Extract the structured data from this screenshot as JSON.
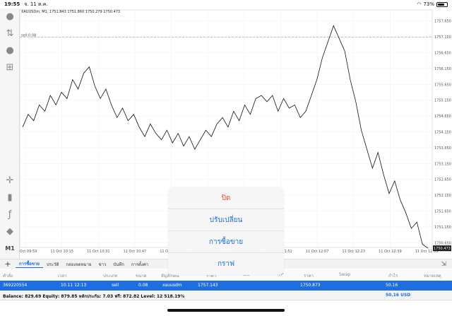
{
  "status_bar": {
    "time": "19:55",
    "date": "จ. 11 ต.ค.",
    "battery": "73%",
    "battery_level": 0.73
  },
  "chart": {
    "symbol_info": "XAUUSDm, M1, 1751.843 1751.860 1750.279 1750.473",
    "sell_label": "sell 0.08",
    "current_price_label": "1750.473",
    "timeframe": "M1"
  },
  "tabs": [
    "การซื้อขาย",
    "ประวัติ",
    "กล่องจดหมาย",
    "ข่าว",
    "บันทึก",
    "การตั้งค่า"
  ],
  "table": {
    "headers": [
      "คำสั่ง",
      "เวลา",
      "ประเภท",
      "ขนาด",
      "สัญลักษณ์",
      "ราคา",
      "S/L",
      "T/P",
      "ราคา",
      "Swap",
      "กำไร",
      "หมายเหตุ"
    ],
    "row": [
      "369220554",
      "10.11 12:13",
      "sell",
      "0.08",
      "xauusdm",
      "1757.143",
      "",
      "",
      "1750.873",
      "",
      "50.16",
      ""
    ]
  },
  "balance": {
    "text": "Balance: 829.69 Equity: 879.85 หลักประกัน: 7.03 ฟรี: 872.82 Level: 12 518.19%",
    "profit": "50.16  USD"
  },
  "sheet": {
    "options": [
      "ปิด",
      "ปรับเปลี่ยน",
      "การซื้อขาย",
      "กราฟ"
    ]
  },
  "chart_data": {
    "type": "line",
    "title": "XAUUSDm, M1, 1751.843 1751.860 1750.279 1750.473",
    "x_ticks": [
      "11 Oct 09:59",
      "11 Oct 10:15",
      "11 Oct 10:31",
      "11 Oct 10:47",
      "11 Oct 11:03",
      "11 Oct 11:19",
      "11 Oct 11:35",
      "11 Oct 11:51",
      "11 Oct 12:07",
      "11 Oct 12:23",
      "11 Oct 12:39",
      "11 Oct 12:55"
    ],
    "y_ticks": [
      1757.65,
      1757.15,
      1756.65,
      1756.15,
      1755.65,
      1755.15,
      1754.65,
      1754.15,
      1753.65,
      1753.15,
      1752.65,
      1752.15,
      1751.65,
      1751.15,
      1750.65
    ],
    "ylim": [
      1750.5,
      1758.0
    ],
    "sell_level": 1757.143,
    "last_price": 1750.473,
    "series": [
      {
        "values": [
          1754.3,
          1754.7,
          1754.5,
          1755.0,
          1754.8,
          1755.3,
          1755.0,
          1755.4,
          1755.2,
          1755.8,
          1755.5,
          1756.0,
          1756.2,
          1755.6,
          1755.2,
          1755.5,
          1755.0,
          1754.6,
          1754.9,
          1754.5,
          1754.7,
          1754.3,
          1754.0,
          1754.4,
          1754.1,
          1753.9,
          1754.2,
          1753.8,
          1754.1,
          1753.7,
          1754.0,
          1753.6,
          1753.9,
          1754.2,
          1754.0,
          1754.4,
          1754.6,
          1754.3,
          1754.8,
          1754.5,
          1755.0,
          1754.7,
          1755.2,
          1755.3,
          1755.1,
          1755.3,
          1754.8,
          1755.2,
          1754.9,
          1755.0,
          1754.6,
          1754.8,
          1755.3,
          1755.8,
          1756.5,
          1757.0,
          1757.5,
          1757.1,
          1756.7,
          1755.8,
          1755.1,
          1754.2,
          1753.6,
          1753.0,
          1753.5,
          1752.8,
          1752.2,
          1752.6,
          1752.0,
          1751.6,
          1751.1,
          1751.3,
          1750.6,
          1750.473
        ]
      }
    ]
  }
}
